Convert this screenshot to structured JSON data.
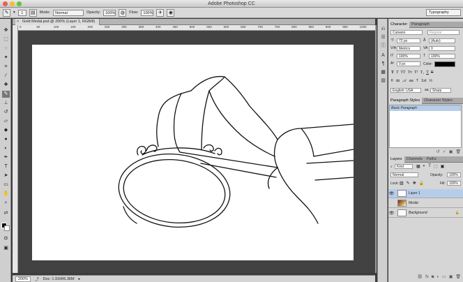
{
  "window": {
    "title": "Adobe Photoshop CC"
  },
  "options_bar": {
    "brush_size": "1",
    "mode_label": "Mode:",
    "mode_value": "Normal",
    "opacity_label": "Opacity:",
    "opacity_value": "100%",
    "flow_label": "Flow:",
    "flow_value": "100%",
    "workspace": "Typography"
  },
  "document": {
    "tab_title": "Gold Medal.psd @ 200% (Layer 1, RGB/8)",
    "ruler_ticks": [
      "0",
      "50",
      "100",
      "150",
      "200",
      "250",
      "300",
      "350",
      "400",
      "450",
      "500",
      "550",
      "600",
      "650",
      "700",
      "750",
      "800",
      "850",
      "900",
      "950",
      "1000"
    ],
    "zoom": "200%",
    "doc_info": "Doc: 1.91M/6.36M"
  },
  "character_panel": {
    "tabs": [
      "Character",
      "Paragraph"
    ],
    "font_family": "Cuisano",
    "font_style": "Regular",
    "font_size": "72 px",
    "leading": "(Auto)",
    "kerning": "Metrics",
    "tracking": "0",
    "vscale": "100%",
    "hscale": "100%",
    "baseline": "0 px",
    "color_label": "Color:",
    "type_buttons": [
      "T",
      "T",
      "TT",
      "Tт",
      "T¹",
      "T₁",
      "T",
      "T"
    ],
    "language": "English: USA",
    "antialias": "Sharp"
  },
  "styles_panel": {
    "tabs": [
      "Paragraph Styles",
      "Character Styles"
    ],
    "items": [
      "Basic Paragraph"
    ]
  },
  "layers_panel": {
    "tabs": [
      "Layers",
      "Channels",
      "Paths"
    ],
    "filter": "Kind",
    "blend_mode": "Normal",
    "opacity_label": "Opacity:",
    "opacity_value": "100%",
    "lock_label": "Lock:",
    "fill_label": "Fill:",
    "fill_value": "100%",
    "layers": [
      {
        "name": "Layer 1",
        "visible": true,
        "selected": true
      },
      {
        "name": "Medal",
        "visible": false,
        "selected": false
      },
      {
        "name": "Background",
        "visible": true,
        "selected": false,
        "locked": true
      }
    ]
  },
  "colors": {
    "foreground": "#000000",
    "background": "#ffffff",
    "selection": "#b6cde9"
  }
}
